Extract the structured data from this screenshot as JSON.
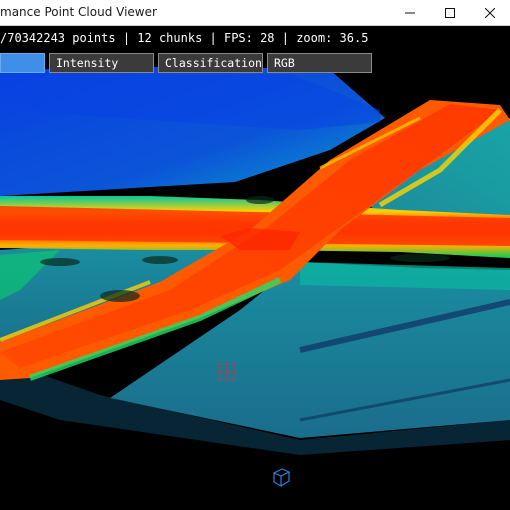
{
  "window": {
    "title": "mance Point Cloud Viewer"
  },
  "status": {
    "text": "/70342243 points | 12 chunks | FPS: 28 | zoom: 36.5"
  },
  "color_modes": {
    "items": [
      "",
      "Intensity",
      "Classification",
      "RGB"
    ],
    "active_index": 0
  },
  "colors": {
    "active_button": "#3f8fe8",
    "button_bg": "#3b3b3b",
    "road_high": "#ff3a00",
    "ground_low": "#0a2fd0",
    "background": "#000000"
  },
  "icons": {
    "minimize": "minimize-icon",
    "maximize": "maximize-icon",
    "close": "close-icon",
    "camera_pivot": "pivot-crosshair-icon",
    "view_cube": "view-cube-icon"
  }
}
